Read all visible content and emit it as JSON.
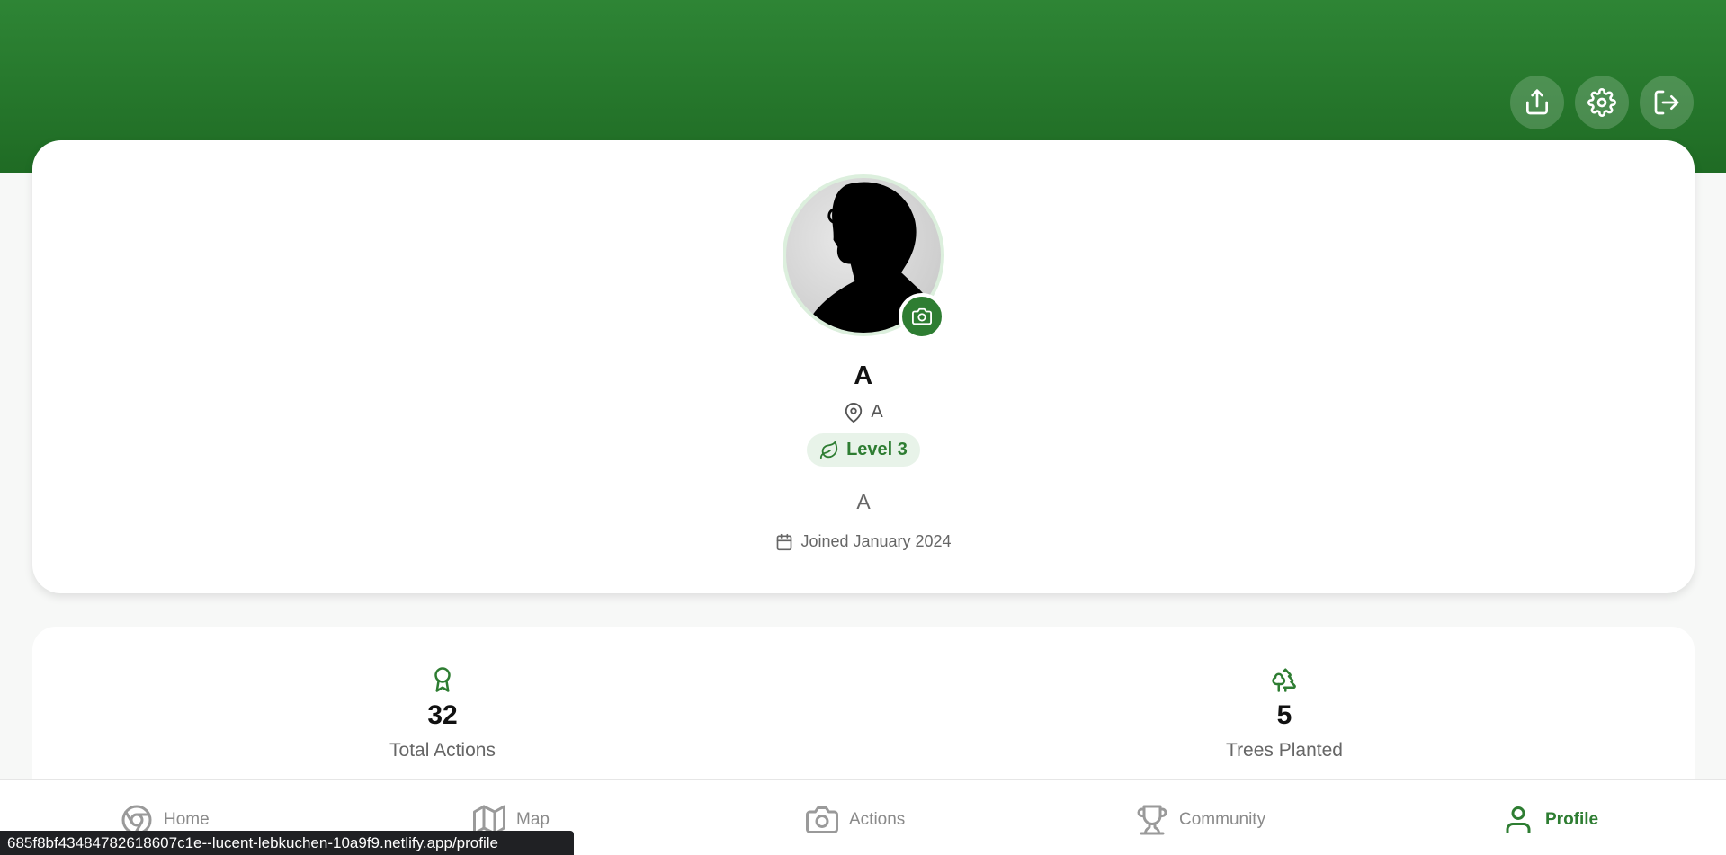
{
  "header": {
    "actions": [
      {
        "name": "share",
        "icon": "share-icon"
      },
      {
        "name": "settings",
        "icon": "gear-icon"
      },
      {
        "name": "logout",
        "icon": "logout-icon"
      }
    ]
  },
  "profile": {
    "name": "A",
    "location": "A",
    "level": "Level 3",
    "bio": "A",
    "joined": "Joined January 2024"
  },
  "stats": [
    {
      "icon": "award-icon",
      "value": "32",
      "label": "Total Actions"
    },
    {
      "icon": "trees-icon",
      "value": "5",
      "label": "Trees Planted"
    }
  ],
  "nav": {
    "items": [
      {
        "label": "Home",
        "icon": "home-circle-icon",
        "active": false
      },
      {
        "label": "Map",
        "icon": "map-icon",
        "active": false
      },
      {
        "label": "Actions",
        "icon": "camera-icon",
        "active": false
      },
      {
        "label": "Community",
        "icon": "trophy-icon",
        "active": false
      },
      {
        "label": "Profile",
        "icon": "user-icon",
        "active": true
      }
    ]
  },
  "status_url": "685f8bf43484782618607c1e--lucent-lebkuchen-10a9f9.netlify.app/profile",
  "colors": {
    "brand_green": "#2e7d32",
    "header_gradient_top": "#2e8535",
    "header_gradient_bottom": "#1f6b24"
  }
}
